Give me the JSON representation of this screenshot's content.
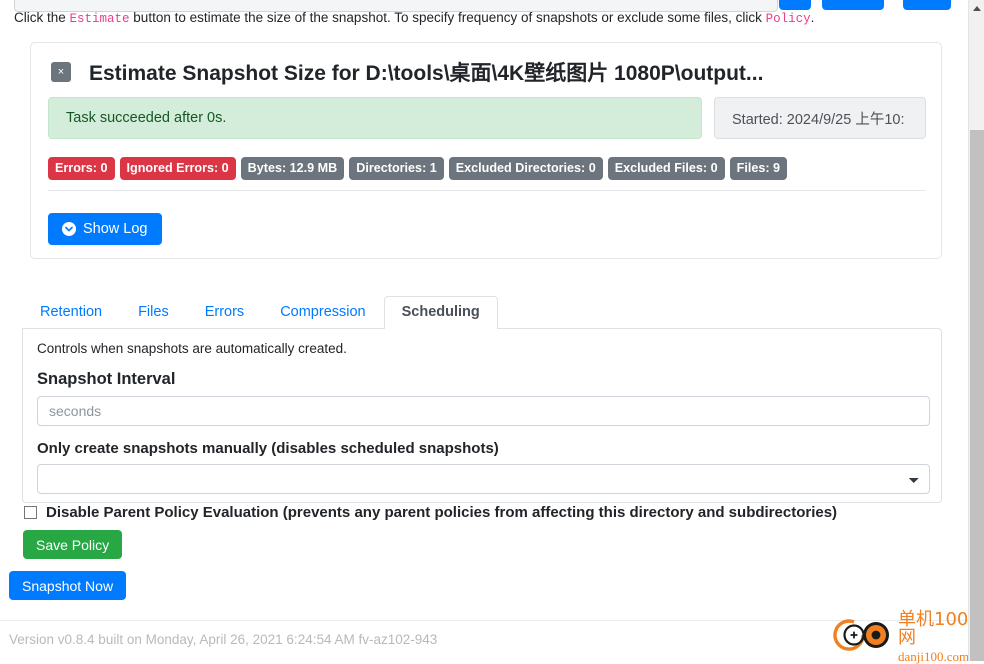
{
  "help": {
    "prefix": "Click the ",
    "code1": "Estimate",
    "middle": " button to estimate the size of the snapshot. To specify frequency of snapshots or exclude some files, click ",
    "code2": "Policy",
    "suffix": "."
  },
  "task_card": {
    "close_label": "×",
    "title": "Estimate Snapshot Size for D:\\tools\\桌面\\4K壁纸图片 1080P\\output...",
    "status_text": "Task succeeded after 0s.",
    "started_text": "Started: 2024/9/25 上午10:",
    "badges": [
      {
        "label": "Errors: 0",
        "style": "danger"
      },
      {
        "label": "Ignored Errors: 0",
        "style": "danger"
      },
      {
        "label": "Bytes: 12.9 MB",
        "style": "secondary"
      },
      {
        "label": "Directories: 1",
        "style": "secondary"
      },
      {
        "label": "Excluded Directories: 0",
        "style": "secondary"
      },
      {
        "label": "Excluded Files: 0",
        "style": "secondary"
      },
      {
        "label": "Files: 9",
        "style": "secondary"
      }
    ],
    "show_log_label": "Show Log"
  },
  "tabs": [
    {
      "label": "Retention",
      "active": false
    },
    {
      "label": "Files",
      "active": false
    },
    {
      "label": "Errors",
      "active": false
    },
    {
      "label": "Compression",
      "active": false
    },
    {
      "label": "Scheduling",
      "active": true
    }
  ],
  "panel": {
    "description": "Controls when snapshots are automatically created.",
    "interval_label": "Snapshot Interval",
    "interval_value": "",
    "interval_placeholder": "seconds",
    "manual_label": "Only create snapshots manually (disables scheduled snapshots)",
    "manual_value": "",
    "manual_options": [
      ""
    ]
  },
  "disable_parent": {
    "label": "Disable Parent Policy Evaluation (prevents any parent policies from affecting this directory and subdirectories)",
    "checked": false
  },
  "actions": {
    "save_policy_label": "Save Policy",
    "snapshot_now_label": "Snapshot Now"
  },
  "footer": {
    "version_text": "Version v0.8.4 built on Monday, April 26, 2021 6:24:54 AM fv-az102-943"
  },
  "watermark": {
    "cn": "单机100网",
    "en": "danji100.com"
  },
  "colors": {
    "primary": "#007bff",
    "success": "#28a745",
    "danger": "#dc3545",
    "secondary": "#6c757d",
    "alert_success_bg": "#d4edda",
    "watermark": "#f08020"
  }
}
